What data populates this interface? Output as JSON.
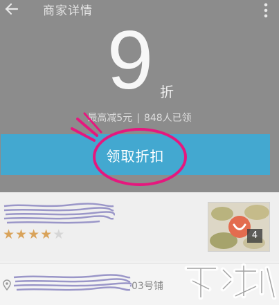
{
  "header": {
    "title": "商家详情"
  },
  "discount": {
    "number": "9",
    "unit": "折",
    "max_saving": "最高减5元",
    "separator": "|",
    "claimed": "848人已领"
  },
  "claim_button": {
    "label": "领取折扣"
  },
  "store": {
    "rating": {
      "value": 4,
      "max": 5
    },
    "photo_count": "4"
  },
  "address": {
    "text": "03号铺"
  },
  "colors": {
    "header_bg": "#8c8c8c",
    "claim_bar": "#43a8d0",
    "annotation": "#e5187e",
    "star": "#d9a35a"
  }
}
